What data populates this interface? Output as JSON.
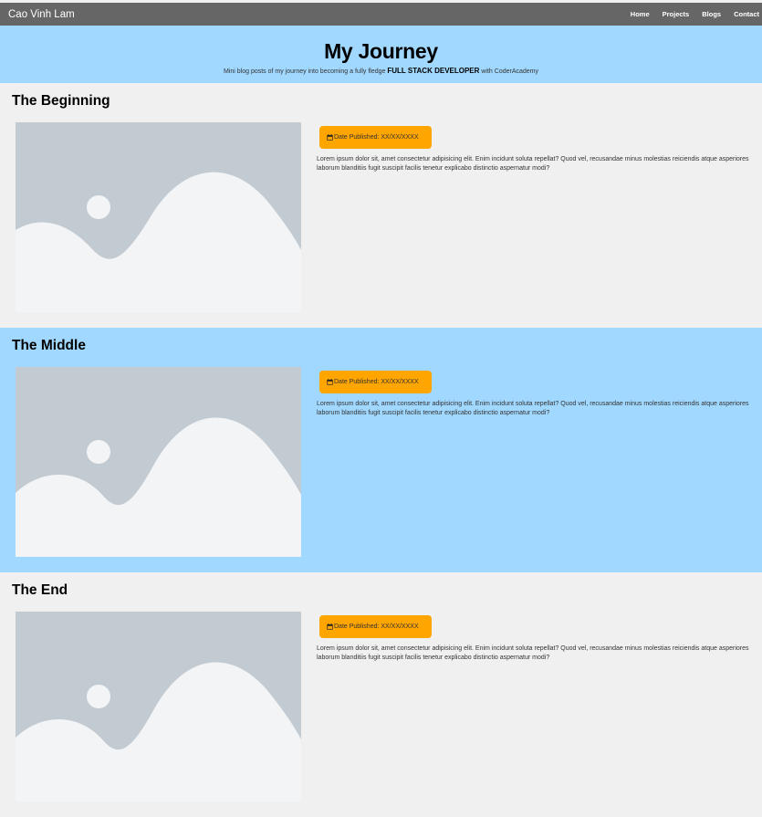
{
  "navbar": {
    "brand": "Cao Vinh Lam",
    "links": [
      "Home",
      "Projects",
      "Blogs",
      "Contact"
    ]
  },
  "hero": {
    "title": "My Journey",
    "subtitle_pre": "Mini blog posts of my journey into becoming a fully fledge",
    "subtitle_strong": "FULL STACK DEVELOPER",
    "subtitle_post": "with CoderAcademy"
  },
  "posts": [
    {
      "title": "The Beginning",
      "date_label": "Date Published: XX/XX/XXXX",
      "body": "Lorem ipsum dolor sit, amet consectetur adipisicing elit. Enim incidunt soluta repellat? Quod vel, recusandae minus molestias reiciendis atque asperiores laborum blanditiis fugit suscipit facilis tenetur explicabo distinctio aspernatur modi?"
    },
    {
      "title": "The Middle",
      "date_label": "Date Published: XX/XX/XXXX",
      "body": "Lorem ipsum dolor sit, amet consectetur adipisicing elit. Enim incidunt soluta repellat? Quod vel, recusandae minus molestias reiciendis atque asperiores laborum blanditiis fugit suscipit facilis tenetur explicabo distinctio aspernatur modi?"
    },
    {
      "title": "The End",
      "date_label": "Date Published: XX/XX/XXXX",
      "body": "Lorem ipsum dolor sit, amet consectetur adipisicing elit. Enim incidunt soluta repellat? Quod vel, recusandae minus molestias reiciendis atque asperiores laborum blanditiis fugit suscipit facilis tenetur explicabo distinctio aspernatur modi?"
    }
  ],
  "icons": {
    "date": "calendar-icon",
    "thumbnail": "image-placeholder-icon"
  },
  "colors": {
    "navbar": "#666666",
    "accent_blue": "#a1d8ff",
    "badge": "#ffa500",
    "background": "#f0f0f0"
  }
}
